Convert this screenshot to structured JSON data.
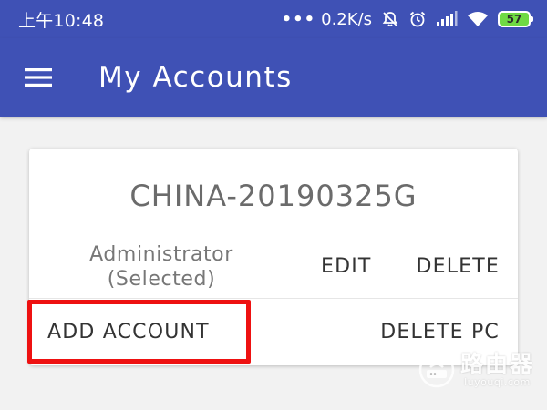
{
  "status_bar": {
    "time": "上午10:48",
    "network_speed": "0.2K/s",
    "battery_level": "57",
    "icons": [
      "mute-bell-icon",
      "alarm-clock-icon",
      "signal-icon",
      "wifi-icon",
      "battery-icon"
    ]
  },
  "app_bar": {
    "title": "My Accounts",
    "menu_icon": "hamburger-menu-icon"
  },
  "card": {
    "pc_name": "CHINA-20190325G",
    "account": {
      "name_line1": "Administrator",
      "name_line2": "(Selected)",
      "edit_label": "EDIT",
      "delete_label": "DELETE"
    },
    "actions": {
      "add_account_label": "ADD ACCOUNT",
      "delete_pc_label": "DELETE PC"
    }
  },
  "colors": {
    "primary": "#3f51b5",
    "background": "#f2f2f2",
    "highlight": "#ee1111",
    "battery": "#6fda44"
  },
  "watermark": {
    "text": "路由器",
    "domain": "luyouqi.com"
  }
}
